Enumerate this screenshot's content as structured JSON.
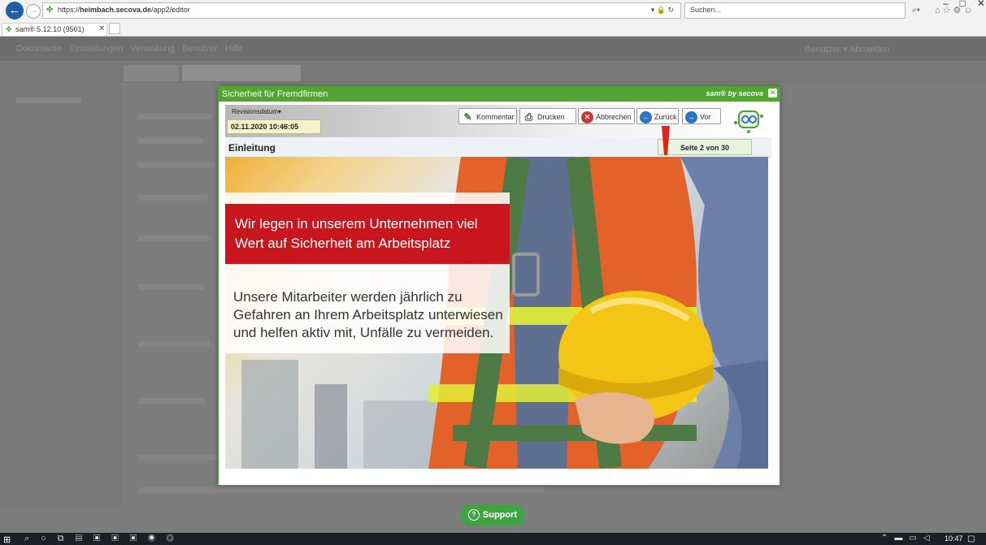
{
  "browser": {
    "url_prefix": "https://",
    "url_domain": "heimbach.secova.de",
    "url_path": "/app2/editor",
    "addr_tools": "▾ 🔒 ↻",
    "search_placeholder": "Suchen...",
    "search_icon": "⌕▾",
    "toolbar_icons": "⌂☆⚙☺",
    "window_controls": "–□✕",
    "tab_title": "sam® 5.12.10 (9501)",
    "tab_close": "✕"
  },
  "app_bar": {
    "items_text": "Dokumente   Einstellungen   Verwaltung   Benutzer   Hilfe",
    "right_text": "Benutzer ▾   Abmelden"
  },
  "modal": {
    "title": "Sicherheit für Fremdfirmen",
    "brand": "sam® by secova",
    "revision_label": "Revisionsdatum",
    "revision_value": "02.11.2020 10:46:05",
    "buttons": {
      "comment": "Kommentar",
      "print": "Drucken",
      "cancel": "Abbrechen",
      "back": "Zurück",
      "next": "Vor"
    },
    "section_title": "Einleitung",
    "page_indicator": "Seite 2 von 30",
    "headline": "Wir legen in unserem Unternehmen viel Wert auf Sicherheit am Arbeitsplatz",
    "body": "Unsere Mitarbeiter werden jährlich zu Gefahren an Ihrem Arbeitsplatz unterwiesen und helfen aktiv mit, Unfälle zu vermeiden."
  },
  "support": {
    "label": "Support",
    "icon": "?"
  },
  "taskbar": {
    "start": "⊞",
    "icons": "⌕○⧉▤▣▣▣◉◎",
    "tray": "⌃▬▭◁",
    "clock": "10:47",
    "notif": "▢"
  },
  "colors": {
    "modal_green": "#52a533",
    "headline_red": "#c9161e",
    "support_green": "#3fa342"
  },
  "icons": {
    "comment": "pencil-icon",
    "print": "printer-icon",
    "cancel": "cancel-icon",
    "back": "arrow-left-icon",
    "next": "arrow-right-icon",
    "alert": "exclamation-icon"
  }
}
